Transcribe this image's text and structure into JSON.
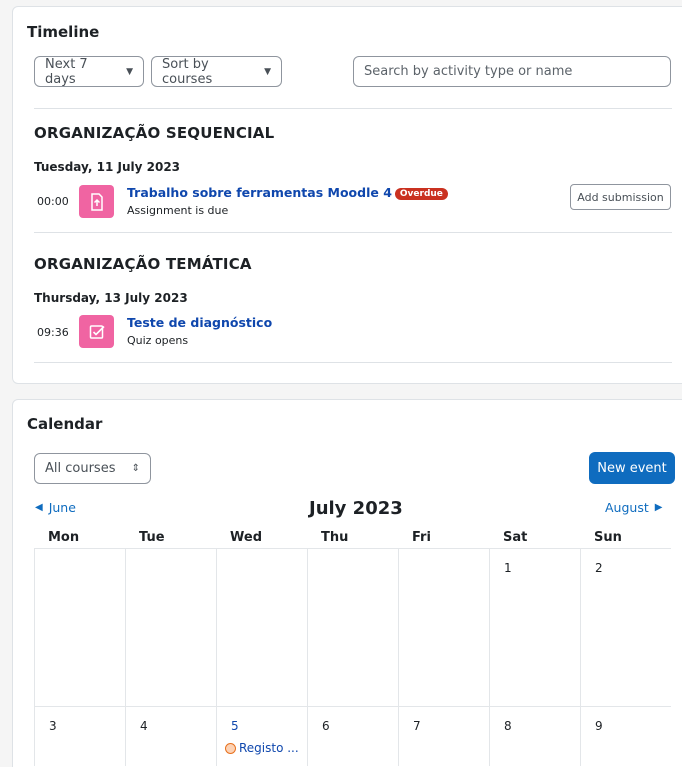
{
  "timeline": {
    "title": "Timeline",
    "filter_days": "Next 7 days",
    "sort_by": "Sort by courses",
    "search_placeholder": "Search by activity type or name",
    "groups": [
      {
        "course": "ORGANIZAÇÃO SEQUENCIAL",
        "date": "Tuesday, 11 July 2023",
        "event": {
          "time": "00:00",
          "name": "Trabalho sobre ferramentas Moodle 4",
          "badge": "Overdue",
          "subtitle": "Assignment is due",
          "action": "Add submission",
          "icon": "assignment-icon"
        }
      },
      {
        "course": "ORGANIZAÇÃO TEMÁTICA",
        "date": "Thursday, 13 July 2023",
        "event": {
          "time": "09:36",
          "name": "Teste de diagnóstico",
          "subtitle": "Quiz opens",
          "icon": "quiz-icon"
        }
      }
    ]
  },
  "calendar": {
    "title": "Calendar",
    "course_filter": "All courses",
    "new_event": "New event",
    "prev_month": "June",
    "next_month": "August",
    "month": "July 2023",
    "weekdays": [
      "Mon",
      "Tue",
      "Wed",
      "Thu",
      "Fri",
      "Sat",
      "Sun"
    ],
    "week1": [
      "",
      "",
      "",
      "",
      "",
      "1",
      "2"
    ],
    "week2": [
      "3",
      "4",
      "5",
      "6",
      "7",
      "8",
      "9"
    ],
    "week2_event": "Registo ..."
  },
  "colors": {
    "accent": "#0f6cbf",
    "link": "#0f47ad",
    "activity_icon": "#f064a2",
    "overdue": "#ca3120"
  }
}
